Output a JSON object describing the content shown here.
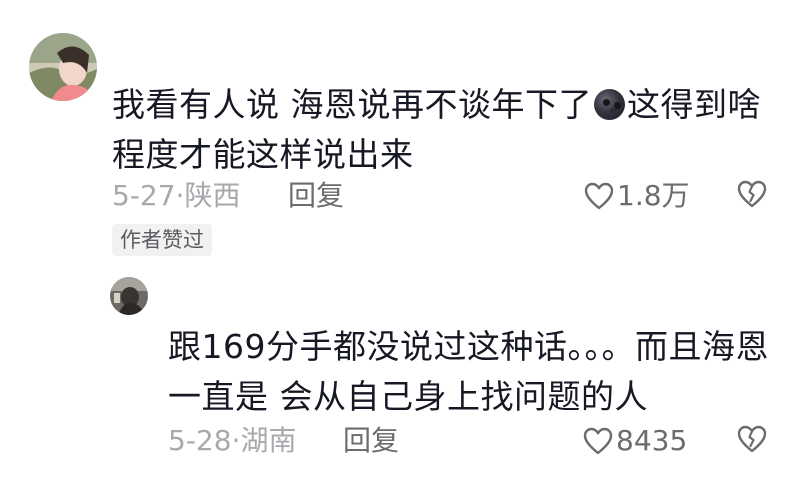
{
  "comment": {
    "text_before_emoji": "我看有人说 海恩说再不谈年下了",
    "emoji": "dark-moon-face-icon",
    "text_after_emoji": "这得到啥程度才能这样说出来",
    "meta": "5-27·陕西",
    "reply_label": "回复",
    "like_count": "1.8万",
    "author_liked_badge": "作者赞过"
  },
  "reply": {
    "text": "跟169分手都没说过这种话。。。而且海恩一直是 会从自己身上找问题的人",
    "meta": "5-28·湖南",
    "reply_label": "回复",
    "like_count": "8435"
  },
  "colors": {
    "text": "#161823",
    "meta": "#a8a8ad",
    "action": "#6b6b70",
    "badge_bg": "#f1f1f2"
  }
}
